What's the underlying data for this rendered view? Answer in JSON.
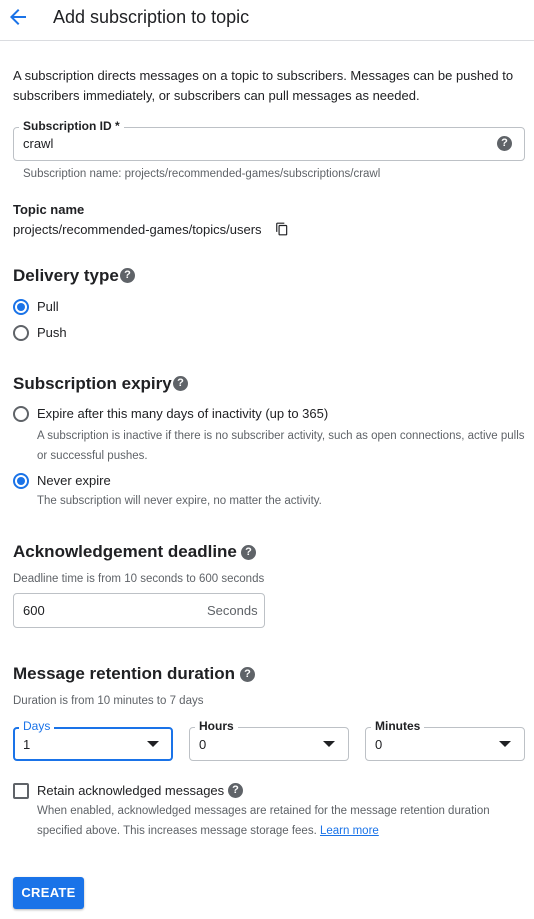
{
  "header": {
    "title": "Add subscription to topic",
    "back_icon": "arrow-back-icon"
  },
  "intro": "A subscription directs messages on a topic to subscribers. Messages can be pushed to subscribers immediately, or subscribers can pull messages as needed.",
  "subscription_id": {
    "label": "Subscription ID *",
    "value": "crawl",
    "hint": "Subscription name: projects/recommended-games/subscriptions/crawl",
    "help_icon": "help-icon"
  },
  "topic": {
    "label": "Topic name",
    "value": "projects/recommended-games/topics/users",
    "copy_icon": "copy-icon"
  },
  "delivery": {
    "title": "Delivery type",
    "options": [
      {
        "label": "Pull",
        "selected": true
      },
      {
        "label": "Push",
        "selected": false
      }
    ]
  },
  "expiry": {
    "title": "Subscription expiry",
    "options": [
      {
        "label": "Expire after this many days of inactivity (up to 365)",
        "hint": "A subscription is inactive if there is no subscriber activity, such as open connections, active pulls or successful pushes.",
        "selected": false
      },
      {
        "label": "Never expire",
        "hint": "The subscription will never expire, no matter the activity.",
        "selected": true
      }
    ]
  },
  "ack": {
    "title": "Acknowledgement deadline",
    "hint": "Deadline time is from 10 seconds to 600 seconds",
    "value": "600",
    "suffix": "Seconds"
  },
  "retention": {
    "title": "Message retention duration",
    "hint": "Duration is from 10 minutes to 7 days",
    "days": {
      "label": "Days",
      "value": "1"
    },
    "hours": {
      "label": "Hours",
      "value": "0"
    },
    "minutes": {
      "label": "Minutes",
      "value": "0"
    }
  },
  "retain": {
    "label": "Retain acknowledged messages",
    "checked": false,
    "hint": "When enabled, acknowledged messages are retained for the message retention duration specified above. This increases message storage fees.",
    "link": "Learn more"
  },
  "create_button": "CREATE",
  "colors": {
    "accent": "#1a73e8",
    "border": "#bdc1c6",
    "text": "#202124",
    "muted": "#5f6368"
  }
}
